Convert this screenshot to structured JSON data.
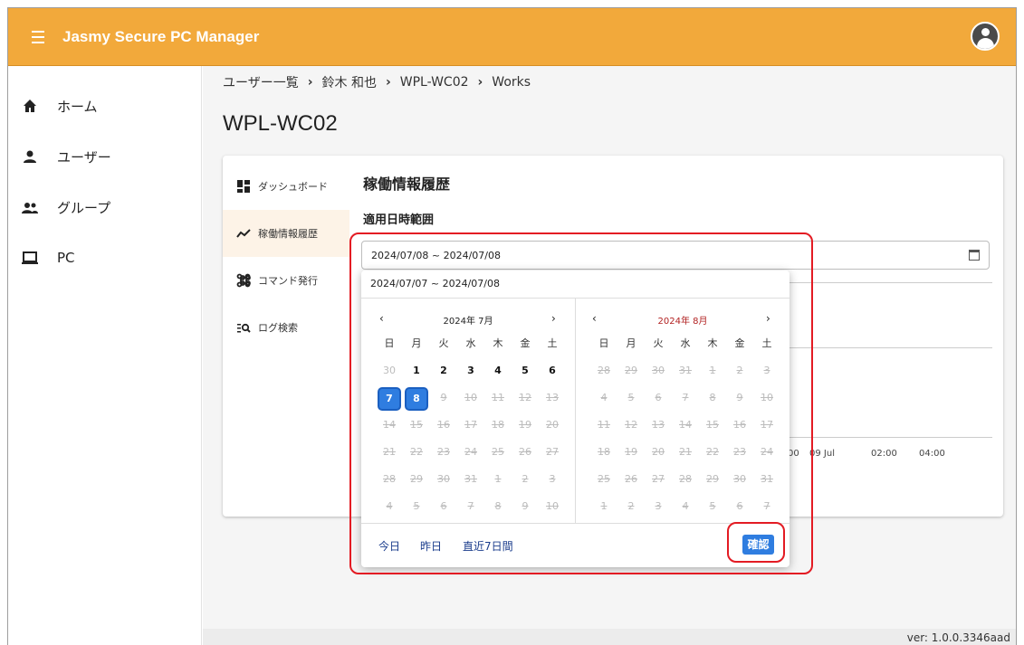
{
  "app": {
    "title": "Jasmy Secure PC Manager"
  },
  "sidebar": {
    "items": [
      {
        "label": "ホーム",
        "icon": "home-icon"
      },
      {
        "label": "ユーザー",
        "icon": "person-icon"
      },
      {
        "label": "グループ",
        "icon": "group-icon"
      },
      {
        "label": "PC",
        "icon": "laptop-icon"
      }
    ]
  },
  "breadcrumb": {
    "items": [
      "ユーザー一覧",
      "鈴木 和也",
      "WPL-WC02",
      "Works"
    ],
    "separator": "›"
  },
  "page": {
    "title": "WPL-WC02"
  },
  "tabs": [
    {
      "label": "ダッシュボード",
      "icon": "dashboard-icon"
    },
    {
      "label": "稼働情報履歴",
      "icon": "trend-icon",
      "active": true
    },
    {
      "label": "コマンド発行",
      "icon": "command-icon"
    },
    {
      "label": "ログ検索",
      "icon": "log-search-icon"
    }
  ],
  "section": {
    "title": "稼働情報履歴",
    "field_label": "適用日時範囲",
    "date_value": "2024/07/08 ~ 2024/07/08"
  },
  "chart": {
    "ticks": [
      "00",
      "09 Jul",
      "02:00",
      "04:00"
    ]
  },
  "picker": {
    "range_text": "2024/07/07 ~ 2024/07/08",
    "weekdays": [
      "日",
      "月",
      "火",
      "水",
      "木",
      "金",
      "土"
    ],
    "left": {
      "title": "2024年 7月",
      "prev": "‹",
      "next": "›",
      "weeks": [
        [
          "30",
          "1",
          "2",
          "3",
          "4",
          "5",
          "6"
        ],
        [
          "7",
          "8",
          "9",
          "10",
          "11",
          "12",
          "13"
        ],
        [
          "14",
          "15",
          "16",
          "17",
          "18",
          "19",
          "20"
        ],
        [
          "21",
          "22",
          "23",
          "24",
          "25",
          "26",
          "27"
        ],
        [
          "28",
          "29",
          "30",
          "31",
          "1",
          "2",
          "3"
        ],
        [
          "4",
          "5",
          "6",
          "7",
          "8",
          "9",
          "10"
        ]
      ]
    },
    "right": {
      "title": "2024年 8月",
      "prev": "‹",
      "next": "›",
      "weeks": [
        [
          "28",
          "29",
          "30",
          "31",
          "1",
          "2",
          "3"
        ],
        [
          "4",
          "5",
          "6",
          "7",
          "8",
          "9",
          "10"
        ],
        [
          "11",
          "12",
          "13",
          "14",
          "15",
          "16",
          "17"
        ],
        [
          "18",
          "19",
          "20",
          "21",
          "22",
          "23",
          "24"
        ],
        [
          "25",
          "26",
          "27",
          "28",
          "29",
          "30",
          "31"
        ],
        [
          "1",
          "2",
          "3",
          "4",
          "5",
          "6",
          "7"
        ]
      ]
    },
    "quick": [
      "今日",
      "昨日",
      "直近7日間"
    ],
    "confirm": "確認"
  },
  "footer": {
    "version": "ver: 1.0.0.3346aad"
  },
  "colors": {
    "appbar": "#f2a93b",
    "accent": "#2f7de0",
    "highlight": "#e31b23",
    "month_title_right": "#b22222"
  }
}
